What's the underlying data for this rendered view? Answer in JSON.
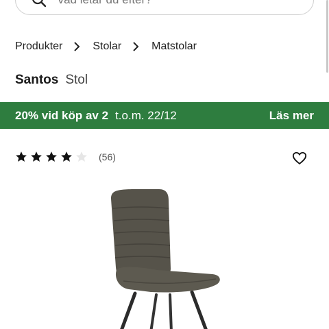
{
  "search": {
    "placeholder": "Vad letar du efter?"
  },
  "breadcrumb": [
    "Produkter",
    "Stolar",
    "Matstolar"
  ],
  "product": {
    "brand": "Santos",
    "type": "Stol"
  },
  "promo": {
    "offer": "20% vid köp av 2",
    "date": "t.o.m. 22/12",
    "link": "Läs mer",
    "bg_color": "#2e7d3f"
  },
  "rating": {
    "stars": 4,
    "max": 5,
    "count": "(56)"
  },
  "icons": {
    "search": "search-icon",
    "chevron": "chevron-right-icon",
    "favorite": "heart-icon",
    "star": "star-icon"
  },
  "image": {
    "subject": "chair-photo"
  }
}
